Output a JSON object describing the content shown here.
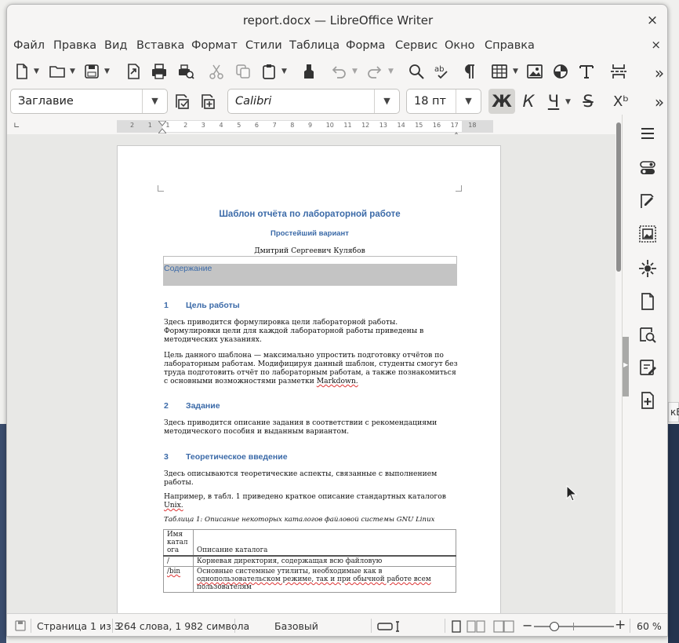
{
  "window": {
    "title": "report.docx — LibreOffice Writer",
    "close_glyph": "×"
  },
  "background_tab": {
    "label": "кВ"
  },
  "menubar": {
    "items": [
      "Файл",
      "Правка",
      "Вид",
      "Вставка",
      "Формат",
      "Стили",
      "Таблица",
      "Форма",
      "Сервис",
      "Окно",
      "Справка"
    ],
    "close_glyph": "×"
  },
  "toolbar": {
    "paragraph_style": "Заглавие",
    "font_name": "Calibri",
    "font_size": "18 пт",
    "bold_label": "Ж",
    "italic_label": "К",
    "underline_label": "Ч",
    "strike_label": "S",
    "superscript_label": "Xᵇ",
    "more_glyph": "»"
  },
  "ruler": {
    "ticks": [
      "2",
      "1",
      "1",
      "2",
      "3",
      "4",
      "5",
      "6",
      "7",
      "8",
      "9",
      "10",
      "11",
      "12",
      "13",
      "14",
      "15",
      "16",
      "17",
      "18"
    ]
  },
  "document": {
    "title": "Шаблон отчёта по лабораторной работе",
    "subtitle": "Простейший вариант",
    "author": "Дмитрий Сергеевич Кулябов",
    "toc_title": "Содержание",
    "sections": [
      {
        "num": "1",
        "title": "Цель работы"
      },
      {
        "num": "2",
        "title": "Задание"
      },
      {
        "num": "3",
        "title": "Теоретическое введение"
      }
    ],
    "p1a": "Здесь приводится формулировка цели лабораторной работы.",
    "p1b": "Формулировки цели для каждой лабораторной работы приведены в",
    "p1c": "методических указаниях.",
    "p2a": "Цель данного шаблона — максимально упростить подготовку отчётов по",
    "p2b": "лабораторным работам. Модифицируя данный шаблон, студенты смогут без",
    "p2c": "труда подготовить отчёт по лабораторным работам, а также познакомиться",
    "p2d": "с основными возможностями разметки ",
    "p2e": "Markdown.",
    "p3a": "Здесь приводится описание задания в соответствии с рекомендациями",
    "p3b": "методического пособия и выданным вариантом.",
    "p4a": "Здесь описываются теоретические аспекты, связанные с выполнением",
    "p4b": "работы.",
    "p5a": "Например, в табл. 1 приведено краткое описание стандартных каталогов",
    "p5b": "Unix.",
    "caption": "Таблица 1: Описание некоторых каталогов файловой системы GNU Linux",
    "table": {
      "head_col1": [
        "Имя",
        "катал",
        "ога"
      ],
      "head_col2": "Описание каталога",
      "rows": [
        {
          "name": "/",
          "desc": [
            "Корневая директория, содержащая всю файловую"
          ]
        },
        {
          "name": "/bin",
          "desc": [
            "Основные системные утилиты, необходимые как в",
            "однопользовательском режиме, так и при обычной работе всем",
            "пользователям"
          ]
        }
      ]
    }
  },
  "statusbar": {
    "page": "Страница 1 из 3",
    "words": "264 слова, 1 982 символа",
    "style": "Базовый",
    "zoom": "60 %",
    "zoom_minus": "−",
    "zoom_plus": "+"
  }
}
